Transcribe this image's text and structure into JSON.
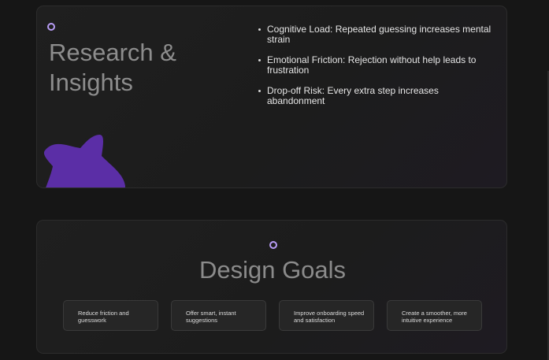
{
  "research": {
    "title_line1": "Research &",
    "title_line2": "Insights",
    "bullets": [
      "Cognitive Load: Repeated guessing increases mental strain",
      "Emotional Friction: Rejection without help leads to frustration",
      "Drop-off Risk: Every extra step increases abandonment"
    ]
  },
  "goals": {
    "title": "Design Goals",
    "chips": [
      "Reduce friction and guesswork",
      "Offer smart, instant suggestions",
      "Improve onboarding speed and satisfaction",
      "Create a smoother, more intuitive experience"
    ]
  },
  "colors": {
    "accent_purple": "#5b2ea6",
    "dot_lavender": "#b79cf5",
    "background": "#161616"
  },
  "icons": {
    "decoration": "star-shape-icon",
    "marker": "ring-dot-icon"
  }
}
